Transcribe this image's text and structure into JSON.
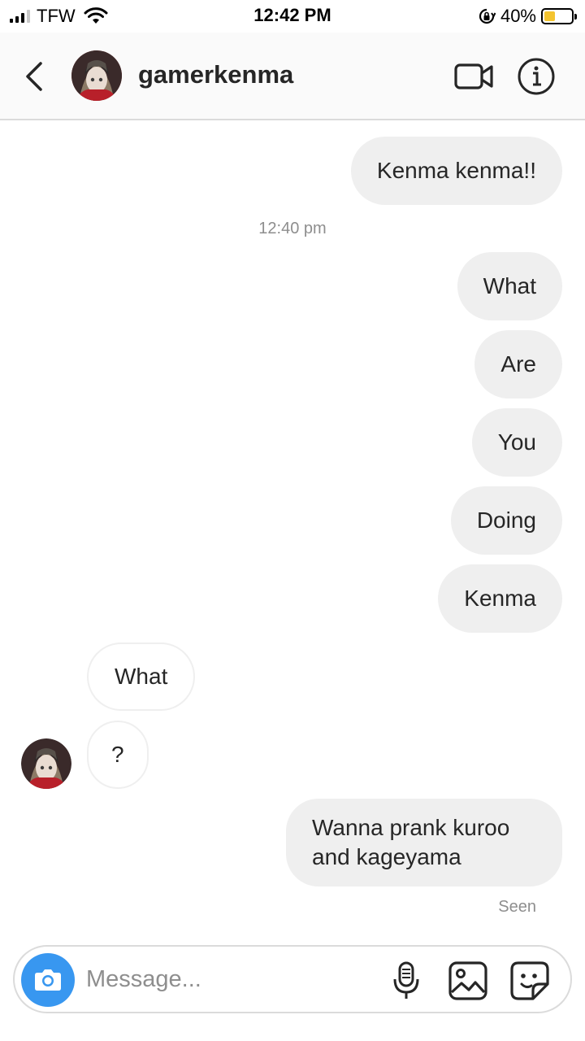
{
  "status_bar": {
    "carrier": "TFW",
    "time": "12:42 PM",
    "battery_percent": "40%",
    "battery_level": 0.4,
    "icons": [
      "signal-icon",
      "wifi-icon",
      "orientation-lock-icon",
      "battery-charging-icon"
    ]
  },
  "header": {
    "username": "gamerkenma",
    "icons": [
      "back-chevron-icon",
      "video-call-icon",
      "info-icon"
    ]
  },
  "messages": {
    "m1": "Kenma kenma!!",
    "timestamp": "12:40 pm",
    "m2": "What",
    "m3": "Are",
    "m4": "You",
    "m5": "Doing",
    "m6": "Kenma",
    "r1": "What",
    "r2": "?",
    "m7": "Wanna prank kuroo and kageyama",
    "seen": "Seen"
  },
  "composer": {
    "placeholder": "Message...",
    "icons": [
      "camera-icon",
      "microphone-icon",
      "gallery-icon",
      "sticker-icon"
    ]
  },
  "colors": {
    "accent": "#3897f0",
    "outgoing_bubble": "#efefef",
    "border": "#dbdbdb",
    "battery_charging": "#f4c430"
  }
}
